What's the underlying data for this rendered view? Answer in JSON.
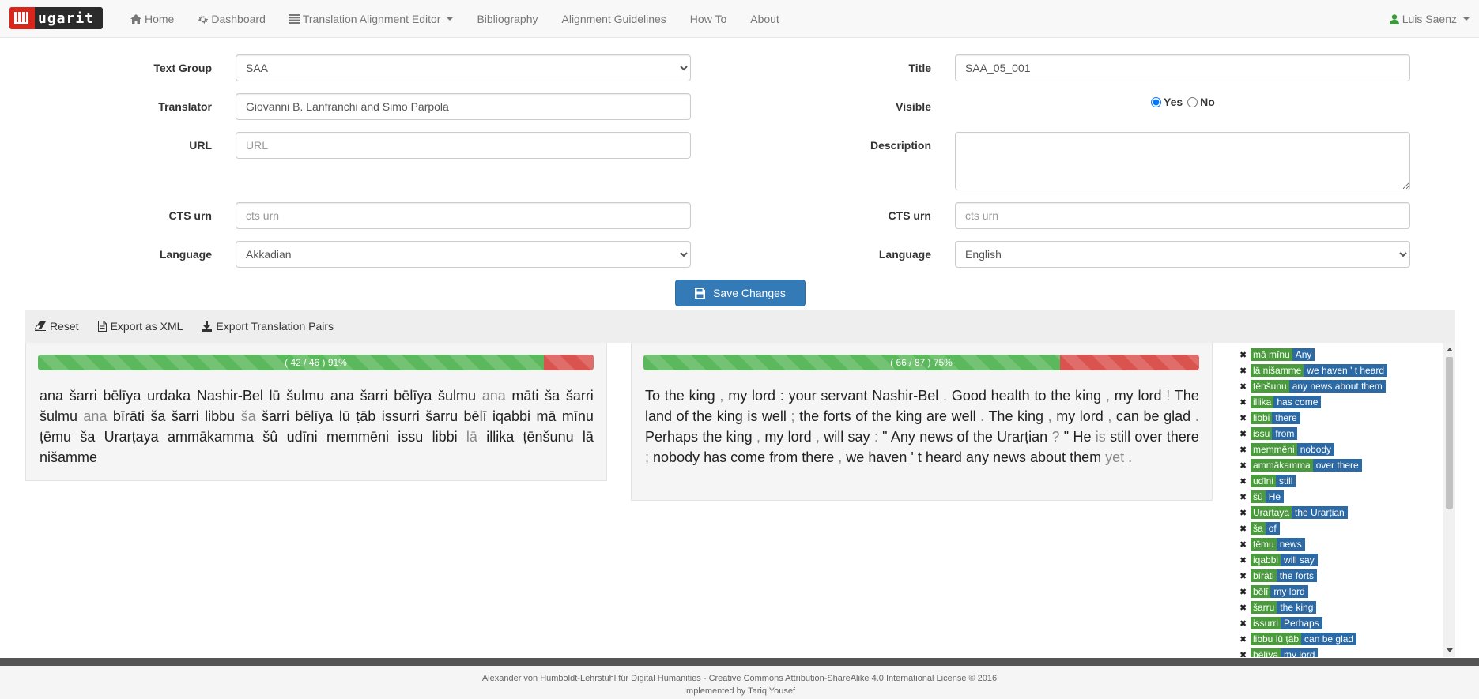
{
  "nav": {
    "brand": "ugarit",
    "items": [
      {
        "label": "Home",
        "icon": "home-icon"
      },
      {
        "label": "Dashboard",
        "icon": "gear-icon"
      },
      {
        "label": "Translation Alignment Editor",
        "icon": "list-icon",
        "dropdown": true
      },
      {
        "label": "Bibliography"
      },
      {
        "label": "Alignment Guidelines"
      },
      {
        "label": "How To"
      },
      {
        "label": "About"
      }
    ],
    "user": "Luis Saenz"
  },
  "form": {
    "text_group_label": "Text Group",
    "text_group_value": "SAA",
    "translator_label": "Translator",
    "translator_value": "Giovanni B. Lanfranchi and Simo Parpola",
    "url_label": "URL",
    "url_placeholder": "URL",
    "cts_left_label": "CTS urn",
    "cts_left_placeholder": "cts urn",
    "language_left_label": "Language",
    "language_left_value": "Akkadian",
    "title_label": "Title",
    "title_value": "SAA_05_001",
    "visible_label": "Visible",
    "visible_yes": "Yes",
    "visible_no": "No",
    "description_label": "Description",
    "description_value": "",
    "cts_right_label": "CTS urn",
    "cts_right_placeholder": "cts urn",
    "language_right_label": "Language",
    "language_right_value": "English",
    "save_label": "Save Changes"
  },
  "toolbar": {
    "reset": "Reset",
    "export_xml": "Export as XML",
    "export_pairs": "Export Translation Pairs"
  },
  "source": {
    "progress_label": "( 42 / 46 ) 91%",
    "progress_fraction": 0.91,
    "tokens": [
      {
        "t": "ana"
      },
      {
        "t": "šarri"
      },
      {
        "t": "bēlīya"
      },
      {
        "t": "urdaka"
      },
      {
        "t": "Nashir-Bel"
      },
      {
        "t": "lū"
      },
      {
        "t": "šulmu"
      },
      {
        "t": "ana"
      },
      {
        "t": "šarri"
      },
      {
        "t": "bēlīya"
      },
      {
        "t": "šulmu"
      },
      {
        "t": "ana",
        "g": true
      },
      {
        "t": "māti"
      },
      {
        "t": "ša"
      },
      {
        "t": "šarri"
      },
      {
        "t": "šulmu"
      },
      {
        "t": "ana",
        "g": true
      },
      {
        "t": "bīrāti"
      },
      {
        "t": "ša"
      },
      {
        "t": "šarri"
      },
      {
        "t": "libbu"
      },
      {
        "t": "ša",
        "g": true
      },
      {
        "t": "šarri"
      },
      {
        "t": "bēlīya"
      },
      {
        "t": "lū"
      },
      {
        "t": "ṭāb"
      },
      {
        "t": "issurri"
      },
      {
        "t": "šarru"
      },
      {
        "t": "bēlī"
      },
      {
        "t": "iqabbi"
      },
      {
        "t": "mā"
      },
      {
        "t": "mīnu"
      },
      {
        "t": "ṭēmu"
      },
      {
        "t": "ša"
      },
      {
        "t": "Urarṭaya"
      },
      {
        "t": "ammākamma"
      },
      {
        "t": "šû"
      },
      {
        "t": "udīni"
      },
      {
        "t": "memmēni"
      },
      {
        "t": "issu"
      },
      {
        "t": "libbi"
      },
      {
        "t": "lā",
        "g": true
      },
      {
        "t": "illika"
      },
      {
        "t": "ṭēnšunu"
      },
      {
        "t": "lā"
      },
      {
        "t": "nišamme"
      }
    ]
  },
  "target": {
    "progress_label": "( 66 / 87 ) 75%",
    "progress_fraction": 0.75,
    "tokens": [
      {
        "t": "To"
      },
      {
        "t": "the"
      },
      {
        "t": "king"
      },
      {
        "t": ",",
        "g": true
      },
      {
        "t": "my"
      },
      {
        "t": "lord"
      },
      {
        "t": ":"
      },
      {
        "t": "your"
      },
      {
        "t": "servant"
      },
      {
        "t": "Nashir-Bel"
      },
      {
        "t": ".",
        "g": true
      },
      {
        "t": "Good"
      },
      {
        "t": "health"
      },
      {
        "t": "to"
      },
      {
        "t": "the"
      },
      {
        "t": "king"
      },
      {
        "t": ",",
        "g": true
      },
      {
        "t": "my"
      },
      {
        "t": "lord"
      },
      {
        "t": "!",
        "g": true
      },
      {
        "t": "The"
      },
      {
        "t": "land"
      },
      {
        "t": "of"
      },
      {
        "t": "the"
      },
      {
        "t": "king"
      },
      {
        "t": "is"
      },
      {
        "t": "well"
      },
      {
        "t": ";",
        "g": true
      },
      {
        "t": "the"
      },
      {
        "t": "forts"
      },
      {
        "t": "of"
      },
      {
        "t": "the"
      },
      {
        "t": "king"
      },
      {
        "t": "are"
      },
      {
        "t": "well"
      },
      {
        "t": ".",
        "g": true
      },
      {
        "t": "The"
      },
      {
        "t": "king"
      },
      {
        "t": ",",
        "g": true
      },
      {
        "t": "my"
      },
      {
        "t": "lord"
      },
      {
        "t": ",",
        "g": true
      },
      {
        "t": "can"
      },
      {
        "t": "be"
      },
      {
        "t": "glad"
      },
      {
        "t": ".",
        "g": true
      },
      {
        "t": "Perhaps"
      },
      {
        "t": "the"
      },
      {
        "t": "king"
      },
      {
        "t": ",",
        "g": true
      },
      {
        "t": "my"
      },
      {
        "t": "lord"
      },
      {
        "t": ",",
        "g": true
      },
      {
        "t": "will"
      },
      {
        "t": "say"
      },
      {
        "t": ":",
        "g": true
      },
      {
        "t": "\""
      },
      {
        "t": "Any"
      },
      {
        "t": "news"
      },
      {
        "t": "of"
      },
      {
        "t": "the"
      },
      {
        "t": "Urarṭian"
      },
      {
        "t": "?",
        "g": true
      },
      {
        "t": "\""
      },
      {
        "t": "He"
      },
      {
        "t": "is",
        "g": true
      },
      {
        "t": "still"
      },
      {
        "t": "over"
      },
      {
        "t": "there"
      },
      {
        "t": ";",
        "g": true
      },
      {
        "t": "nobody"
      },
      {
        "t": "has"
      },
      {
        "t": "come"
      },
      {
        "t": "from"
      },
      {
        "t": "there"
      },
      {
        "t": ",",
        "g": true
      },
      {
        "t": "we"
      },
      {
        "t": "haven"
      },
      {
        "t": "'"
      },
      {
        "t": "t"
      },
      {
        "t": "heard"
      },
      {
        "t": "any"
      },
      {
        "t": "news"
      },
      {
        "t": "about"
      },
      {
        "t": "them"
      },
      {
        "t": "yet",
        "g": true
      },
      {
        "t": ".",
        "g": true
      }
    ]
  },
  "pairs": [
    {
      "src": "mā mīnu",
      "tgt": "Any"
    },
    {
      "src": "lā nišamme",
      "tgt": "we haven ' t heard"
    },
    {
      "src": "ṭēnšunu",
      "tgt": "any news about them"
    },
    {
      "src": "illika",
      "tgt": "has come"
    },
    {
      "src": "libbi",
      "tgt": "there"
    },
    {
      "src": "issu",
      "tgt": "from"
    },
    {
      "src": "memmēni",
      "tgt": "nobody"
    },
    {
      "src": "ammākamma",
      "tgt": "over there"
    },
    {
      "src": "udīni",
      "tgt": "still"
    },
    {
      "src": "šû",
      "tgt": "He"
    },
    {
      "src": "Urarṭaya",
      "tgt": "the Urarṭian"
    },
    {
      "src": "ša",
      "tgt": "of"
    },
    {
      "src": "ṭēmu",
      "tgt": "news"
    },
    {
      "src": "iqabbi",
      "tgt": "will say"
    },
    {
      "src": "bīrāti",
      "tgt": "the forts"
    },
    {
      "src": "bēlī",
      "tgt": "my lord"
    },
    {
      "src": "šarru",
      "tgt": "the king"
    },
    {
      "src": "issurri",
      "tgt": "Perhaps"
    },
    {
      "src": "libbu lū ṭāb",
      "tgt": "can be glad"
    },
    {
      "src": "bēlīya",
      "tgt": "my lord"
    }
  ],
  "footer": {
    "line1": "Alexander von Humboldt-Lehrstuhl für Digital Humanities - Creative Commons Attribution-ShareAlike 4.0 International License © 2016",
    "line2": "Implemented by Tariq Yousef"
  }
}
